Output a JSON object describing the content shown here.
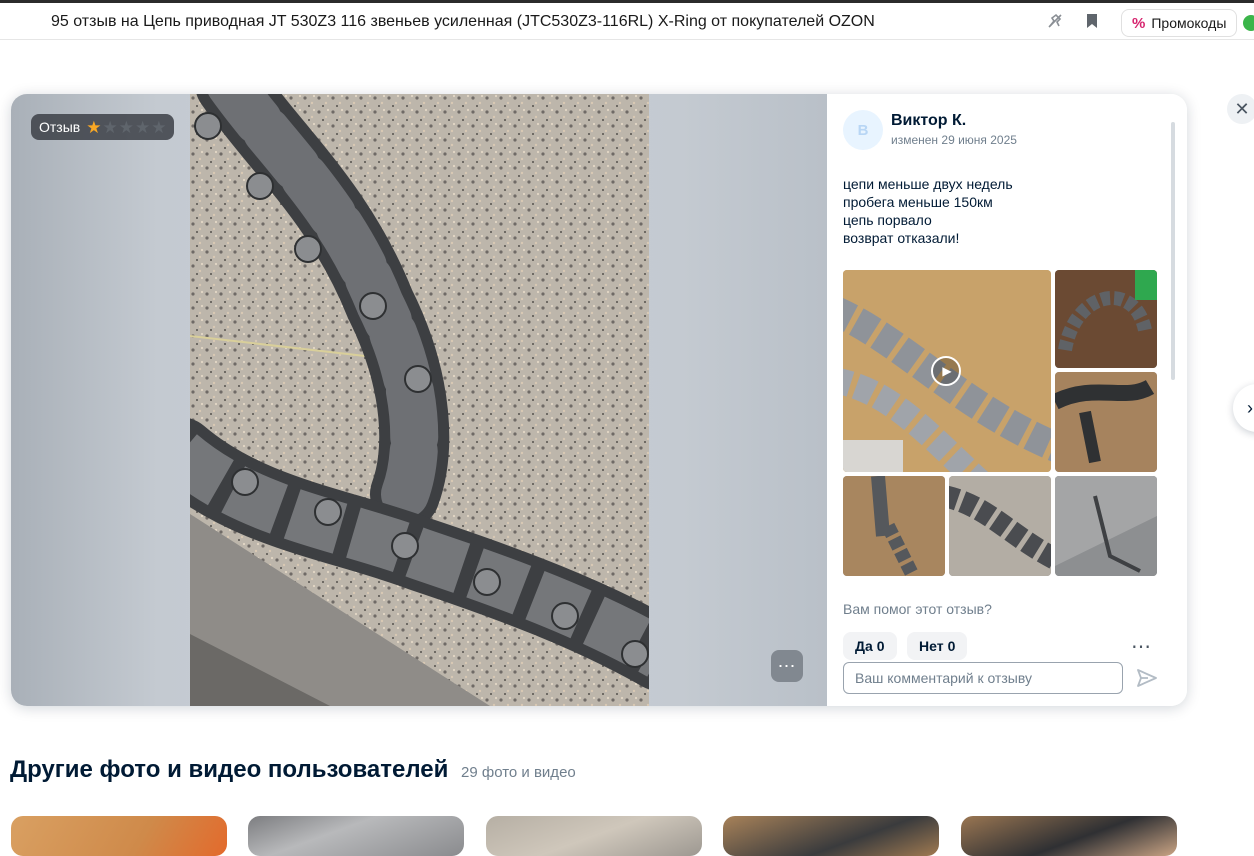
{
  "browser": {
    "tab_title": "95 отзыв на Цепь приводная JT 530Z3 116 звеньев усиленная (JTC530Z3-116RL) X-Ring от покупателей OZON",
    "promo_label": "Промокоды",
    "promo_symbol": "%"
  },
  "media": {
    "rating_label": "Отзыв",
    "rating_value": 1,
    "rating_max": 5,
    "star_filled_color": "#f9a825",
    "star_empty_color": "#5f656c"
  },
  "review": {
    "avatar_letter": "В",
    "author": "Виктор К.",
    "edited": "изменен 29 июня 2025",
    "lines": [
      "цепи меньше двух недель",
      "пробега меньше 150км",
      "цепь порвало",
      "возврат отказали!"
    ],
    "helpful_question": "Вам помог этот отзыв?",
    "vote_yes_label": "Да",
    "vote_yes_count": "0",
    "vote_no_label": "Нет",
    "vote_no_count": "0",
    "comment_placeholder": "Ваш комментарий к отзыву"
  },
  "section": {
    "title": "Другие фото и видео пользователей",
    "count": "29 фото и видео"
  },
  "icons": {
    "play": "play-icon",
    "send": "send-icon",
    "close": "close-icon",
    "more": "more-icon",
    "next": "chevron-right-icon"
  }
}
